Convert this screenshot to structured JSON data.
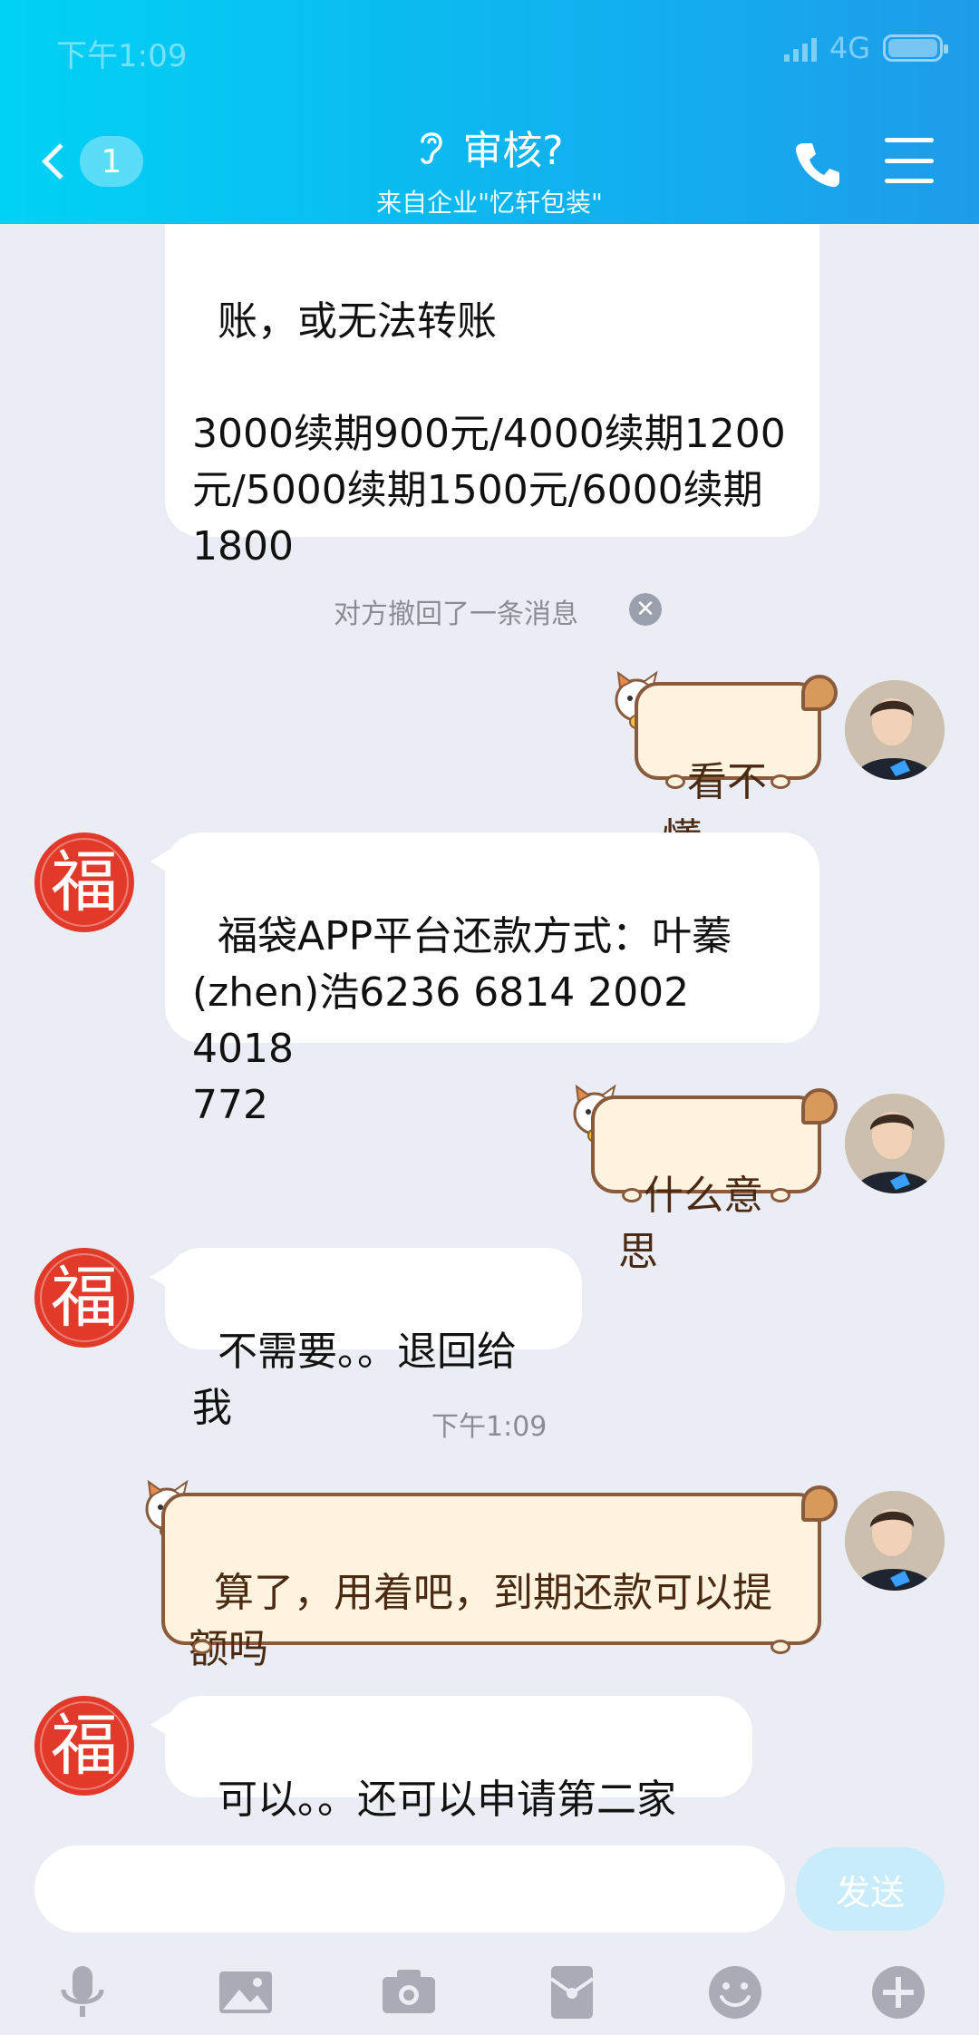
{
  "status_bar": {
    "time": "下午1:09",
    "network": "4G"
  },
  "header": {
    "unread_count": "1",
    "title": "审核?",
    "subtitle": "来自企业\"忆轩包装\"",
    "colors": {
      "gradient_start": "#00d2f5",
      "gradient_end": "#1e9cea"
    }
  },
  "messages": [
    {
      "side": "left",
      "text": "账，或无法转账\n\n3000续期900元/4000续期1200\n元/5000续期1500元/6000续期\n1800"
    },
    {
      "side": "system",
      "text": "对方撤回了一条消息"
    },
    {
      "side": "right",
      "text": "看不懂"
    },
    {
      "side": "left",
      "text": "福袋APP平台还款方式：叶蓁\n(zhen)浩6236 6814 2002 4018\n772"
    },
    {
      "side": "right",
      "text": "什么意思"
    },
    {
      "side": "left",
      "text": "不需要。。退回给我"
    },
    {
      "side": "system",
      "text": "下午1:09"
    },
    {
      "side": "right",
      "text": "算了，用着吧，到期还款可以提\n额吗"
    },
    {
      "side": "left",
      "text": "可以。。还可以申请第二家"
    }
  ],
  "avatars": {
    "contact_char": "福",
    "contact_color": "#e23a2a"
  },
  "input": {
    "placeholder": "",
    "send_label": "发送"
  },
  "toolbar": {
    "icons": [
      "microphone-icon",
      "image-icon",
      "camera-icon",
      "red-packet-icon",
      "emoji-icon",
      "plus-icon"
    ]
  }
}
